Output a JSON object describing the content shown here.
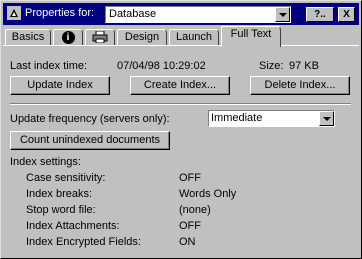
{
  "titlebar": {
    "label": "Properties for:",
    "object_type": "Database",
    "help_label": "?..",
    "close_label": "X"
  },
  "tabs": [
    {
      "label": "Basics"
    },
    {
      "label": "",
      "icon": "info-icon"
    },
    {
      "label": "",
      "icon": "printer-icon"
    },
    {
      "label": "Design"
    },
    {
      "label": "Launch"
    },
    {
      "label": "Full Text",
      "active": true
    }
  ],
  "index_info": {
    "last_index_label": "Last index time:",
    "last_index_value": "07/04/98 10:29:02",
    "size_label": "Size:",
    "size_value": "97 KB"
  },
  "buttons": {
    "update_index": "Update Index",
    "create_index": "Create Index...",
    "delete_index": "Delete Index...",
    "count_unindexed": "Count unindexed documents"
  },
  "update_frequency": {
    "label": "Update frequency (servers only):",
    "selected": "Immediate"
  },
  "index_settings": {
    "heading": "Index settings:",
    "rows": [
      {
        "label": "Case sensitivity:",
        "value": "OFF"
      },
      {
        "label": "Index breaks:",
        "value": "Words Only"
      },
      {
        "label": "Stop word file:",
        "value": "(none)"
      },
      {
        "label": "Index Attachments:",
        "value": "OFF"
      },
      {
        "label": "Index Encrypted Fields:",
        "value": "ON"
      }
    ]
  },
  "colors": {
    "titlebar": "#000080",
    "face": "#c0c0c0"
  }
}
